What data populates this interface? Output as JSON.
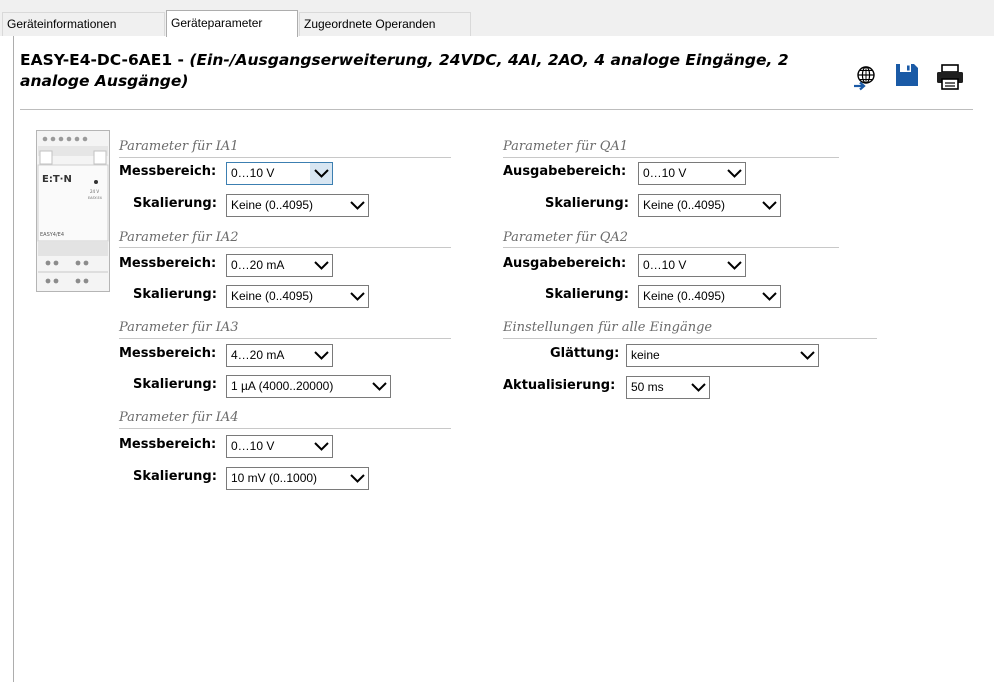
{
  "tabs": [
    {
      "label": "Geräteinformationen"
    },
    {
      "label": "Geräteparameter"
    },
    {
      "label": "Zugeordnete Operanden"
    }
  ],
  "header": {
    "device": "EASY-E4-DC-6AE1",
    "separator": " - ",
    "description": "(Ein-/Ausgangserweiterung, 24VDC, 4AI, 2AO, 4 analoge Eingänge, 2 analoge Ausgänge)",
    "icons": [
      "globe-export-icon",
      "save-icon",
      "print-icon"
    ]
  },
  "device_image": {
    "brand": "E:T·N",
    "model": "EASY4/E4"
  },
  "inputs": [
    {
      "title": "Parameter für IA1",
      "range_label": "Messbereich:",
      "range_value": "0…10 V",
      "scaling_label": "Skalierung:",
      "scaling_value": "Keine (0..4095)"
    },
    {
      "title": "Parameter für IA2",
      "range_label": "Messbereich:",
      "range_value": "0…20 mA",
      "scaling_label": "Skalierung:",
      "scaling_value": "Keine (0..4095)"
    },
    {
      "title": "Parameter für IA3",
      "range_label": "Messbereich:",
      "range_value": "4…20 mA",
      "scaling_label": "Skalierung:",
      "scaling_value": "1 µA (4000..20000)"
    },
    {
      "title": "Parameter für IA4",
      "range_label": "Messbereich:",
      "range_value": "0…10 V",
      "scaling_label": "Skalierung:",
      "scaling_value": "10 mV (0..1000)"
    }
  ],
  "outputs": [
    {
      "title": "Parameter für QA1",
      "range_label": "Ausgabebereich:",
      "range_value": "0…10 V",
      "scaling_label": "Skalierung:",
      "scaling_value": "Keine (0..4095)"
    },
    {
      "title": "Parameter für QA2",
      "range_label": "Ausgabebereich:",
      "range_value": "0…10 V",
      "scaling_label": "Skalierung:",
      "scaling_value": "Keine (0..4095)"
    }
  ],
  "all_inputs": {
    "title": "Einstellungen für alle Eingänge",
    "smoothing_label": "Glättung:",
    "smoothing_value": "keine",
    "update_label": "Aktualisierung:",
    "update_value": "50 ms"
  },
  "colors": {
    "accent": "#1a5aa6",
    "section_title": "#6b6b6b",
    "focus_border": "#3c7fb1"
  }
}
